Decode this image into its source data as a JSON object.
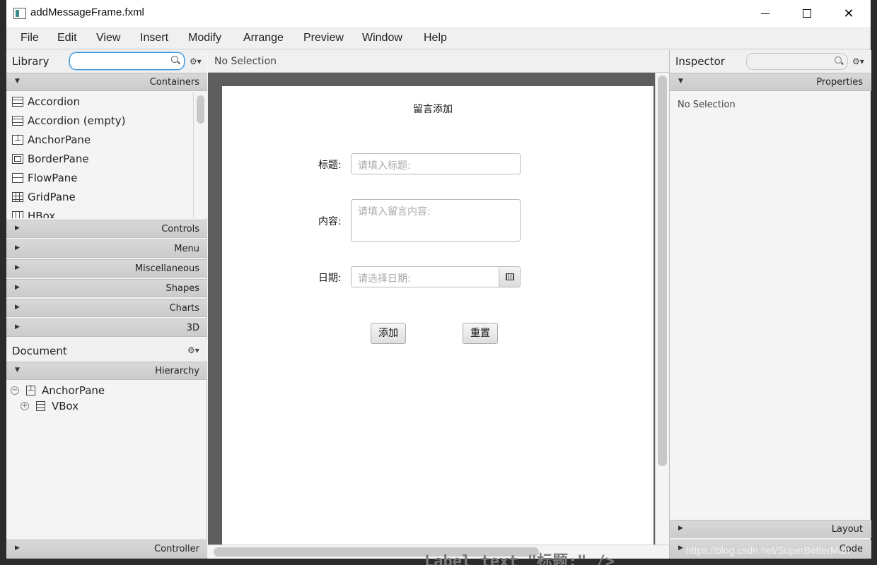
{
  "window": {
    "title": "addMessageFrame.fxml"
  },
  "menu": [
    "File",
    "Edit",
    "View",
    "Insert",
    "Modify",
    "Arrange",
    "Preview",
    "Window",
    "Help"
  ],
  "library": {
    "title": "Library",
    "search_value": "",
    "sections": {
      "containers": "Containers",
      "controls": "Controls",
      "menu": "Menu",
      "miscellaneous": "Miscellaneous",
      "shapes": "Shapes",
      "charts": "Charts",
      "three_d": "3D"
    },
    "items": [
      {
        "label": "Accordion",
        "icon": "accordion-icon"
      },
      {
        "label": "Accordion  (empty)",
        "icon": "accordion-icon"
      },
      {
        "label": "AnchorPane",
        "icon": "anchorpane-icon"
      },
      {
        "label": "BorderPane",
        "icon": "borderpane-icon"
      },
      {
        "label": "FlowPane",
        "icon": "flowpane-icon"
      },
      {
        "label": "GridPane",
        "icon": "gridpane-icon"
      },
      {
        "label": "HBox",
        "icon": "hbox-icon"
      }
    ]
  },
  "document": {
    "title": "Document",
    "hierarchy_label": "Hierarchy",
    "controller_label": "Controller",
    "tree": [
      {
        "label": "AnchorPane",
        "toggle": "−"
      },
      {
        "label": "VBox",
        "toggle": "+"
      }
    ]
  },
  "center": {
    "selection_text": "No Selection",
    "form": {
      "title": "留言添加",
      "title_label": "标题:",
      "title_placeholder": "请填入标题:",
      "content_label": "内容:",
      "content_placeholder": "请填入留言内容:",
      "date_label": "日期:",
      "date_placeholder": "请选择日期:",
      "add_button": "添加",
      "reset_button": "重置"
    }
  },
  "inspector": {
    "title": "Inspector",
    "properties_label": "Properties",
    "no_selection": "No Selection",
    "layout_label": "Layout",
    "code_label": "Code"
  },
  "watermark": "https://blog.csdn.net/SuperBetterMan",
  "background_code": "Label  text  \"标题:\" />"
}
